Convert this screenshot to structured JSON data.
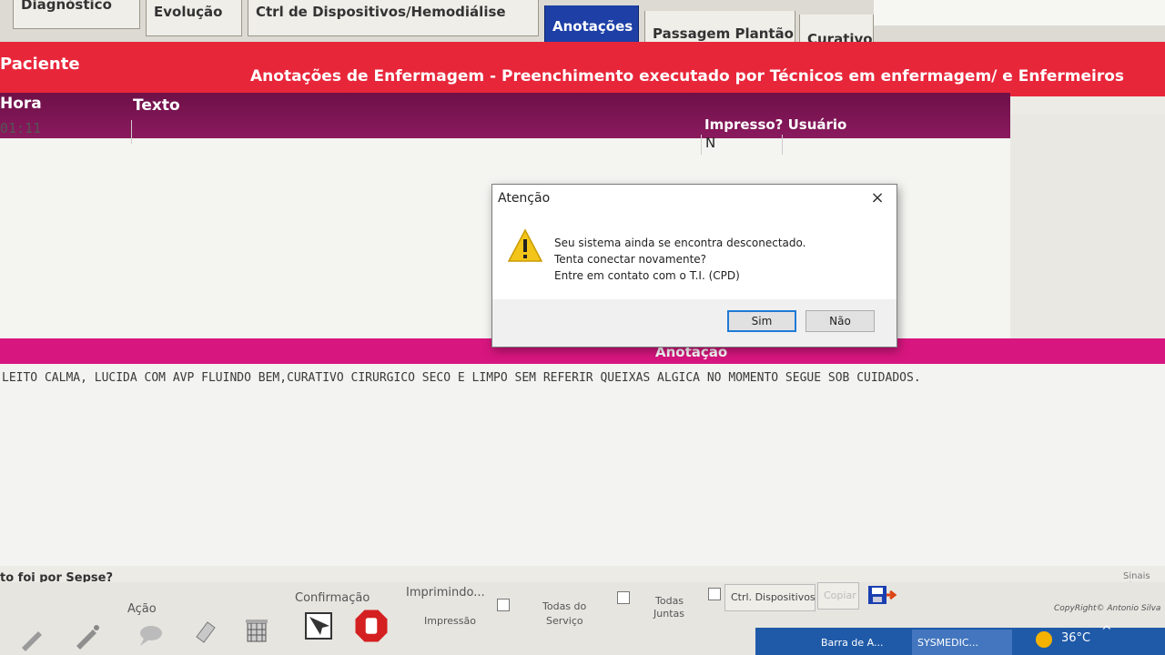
{
  "tabs": [
    {
      "label": "Diagnóstico",
      "active": false
    },
    {
      "label": "Evolução",
      "active": false
    },
    {
      "label": "Ctrl de Dispositivos/Hemodiálise",
      "active": false
    },
    {
      "label": "Anotações",
      "active": true
    },
    {
      "label": "Passagem Plantão",
      "active": false
    },
    {
      "label": "Curativo",
      "active": false
    }
  ],
  "header": {
    "paciente": "Paciente",
    "title": "Anotações de Enfermagem - Preenchimento executado por Técnicos em enfermagem/ e Enfermeiros"
  },
  "grid": {
    "columns": {
      "hora": "Hora",
      "texto": "Texto",
      "impresso_usuario": "Impresso? Usuário"
    },
    "rows": [
      {
        "hora": "01:11",
        "texto": "",
        "impresso": "N",
        "usuario": ""
      }
    ]
  },
  "anotacao": {
    "label": "Anotação",
    "text": "LEITO CALMA, LUCIDA COM AVP FLUINDO BEM,CURATIVO CIRURGICO SECO E LIMPO SEM REFERIR QUEIXAS ALGICA NO MOMENTO SEGUE SOB CUIDADOS."
  },
  "sepse_question": "to foi por Sepse?",
  "sinais_label": "Sinais Vit",
  "toolbar": {
    "acao": "Ação",
    "confirmacao": "Confirmação",
    "imprimindo": "Imprimindo...",
    "impressao": "Impressão",
    "todas_do_servico_1": "Todas do",
    "todas_do_servico_2": "Serviço",
    "todas_juntas_1": "Todas",
    "todas_juntas_2": "Juntas",
    "ctrl_dispositivos": "Ctrl. Dispositivos",
    "copiar": "Copiar",
    "copyright": "CopyRight© Antonio Silva"
  },
  "taskbar": {
    "items": [
      "Barra de A...",
      "SYSMEDIC..."
    ],
    "temperature": "36°C"
  },
  "dialog": {
    "title": "Atenção",
    "line1": "Seu sistema ainda se encontra desconectado.",
    "line2": "Tenta conectar novamente?",
    "line3": "Entre em contato com o T.I. (CPD)",
    "yes": "Sim",
    "no": "Não"
  },
  "colors": {
    "red_header": "#e8263a",
    "purple_header": "#6e1048",
    "pink_bar": "#d8167f",
    "active_tab": "#1d3fa6"
  }
}
